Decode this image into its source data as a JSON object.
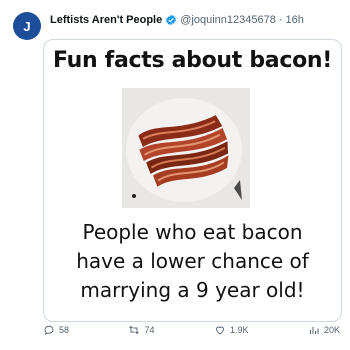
{
  "tweet": {
    "display_name": "Leftists Aren't People",
    "handle": "@joquinn12345678",
    "time": "16h",
    "separator": "·",
    "avatar_initial": "J"
  },
  "media": {
    "headline": "Fun facts about bacon!",
    "lines": [
      "People who eat bacon",
      "have a lower chance of",
      "marrying a 9 year old!"
    ]
  },
  "actions": {
    "replies": "58",
    "retweets": "74",
    "likes": "1.9K",
    "views": "20K"
  },
  "colors": {
    "verified": "#1d9bf0",
    "avatar": "#1d4e9a",
    "muted": "#536471"
  },
  "icons": [
    "verified-badge-icon",
    "reply-icon",
    "retweet-icon",
    "like-icon",
    "views-icon"
  ]
}
